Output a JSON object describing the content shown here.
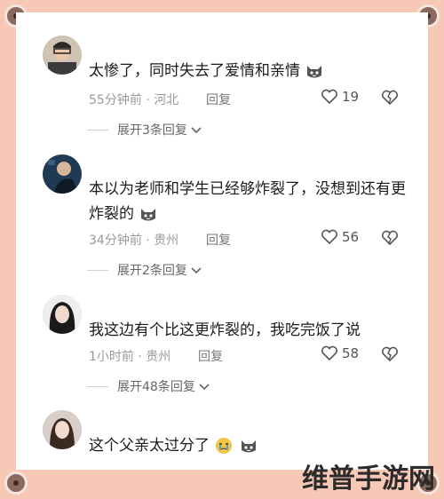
{
  "comments": [
    {
      "text": "太惨了，同时失去了爱情和亲情",
      "time": "55分钟前",
      "location": "河北",
      "reply": "回复",
      "likes": "19",
      "expand": "展开3条回复"
    },
    {
      "text": "本以为老师和学生已经够炸裂了，没想到还有更炸裂的",
      "time": "34分钟前",
      "location": "贵州",
      "reply": "回复",
      "likes": "56",
      "expand": "展开2条回复"
    },
    {
      "text": "我这边有个比这更炸裂的，我吃完饭了说",
      "time": "1小时前",
      "location": "贵州",
      "reply": "回复",
      "likes": "58",
      "expand": "展开48条回复"
    },
    {
      "text": "这个父亲太过分了",
      "time": "",
      "location": "",
      "reply": "",
      "likes": "",
      "expand": ""
    }
  ],
  "separator": "·",
  "watermark": "维普手游网",
  "colors": {
    "background": "#f8c8b6",
    "card": "#ffffff",
    "text": "#1b1b1b",
    "meta": "#9a9a9a"
  }
}
